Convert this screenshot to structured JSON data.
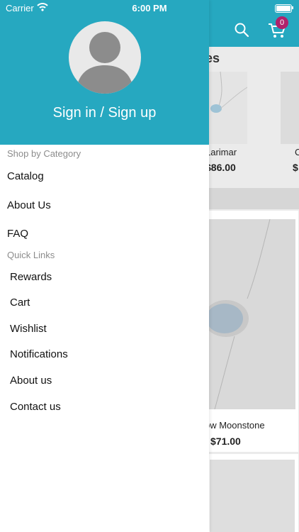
{
  "status_bar": {
    "carrier": "Carrier",
    "time": "6:00 PM",
    "battery_level": 1.0
  },
  "drawer": {
    "header": {
      "signin_label": "Sign in / Sign up",
      "avatar_icon": "user-avatar-placeholder",
      "background_color": "#26a8c0"
    },
    "shop_by_category": {
      "title": "Shop by Category",
      "items": [
        {
          "label": "Catalog"
        },
        {
          "label": "About Us"
        },
        {
          "label": "FAQ"
        }
      ]
    },
    "quick_links": {
      "title": "Quick Links",
      "items": [
        {
          "label": "Rewards"
        },
        {
          "label": "Cart"
        },
        {
          "label": "Wishlist"
        },
        {
          "label": "Notifications"
        },
        {
          "label": "About us"
        },
        {
          "label": "Contact us"
        }
      ]
    }
  },
  "background_app": {
    "cart_count": "0",
    "section_title_fragment": "es",
    "products_row": [
      {
        "name_fragment": "Larimar",
        "price_fragment": "$86.00"
      },
      {
        "name_fragment": "C",
        "price_fragment": "$"
      }
    ],
    "featured_product": {
      "name_fragment": "ow Moonstone",
      "price_fragment": "$71.00"
    },
    "accent_color": "#26a8c0",
    "badge_color": "#b0226b"
  }
}
